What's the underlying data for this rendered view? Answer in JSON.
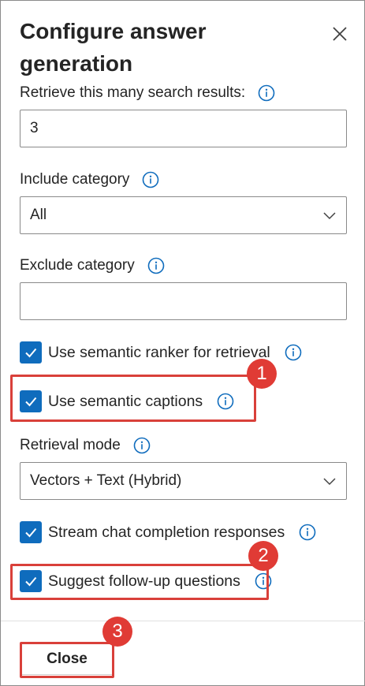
{
  "panel": {
    "title": "Configure answer generation",
    "close_icon": "close-icon"
  },
  "retrieve_count": {
    "label": "Retrieve this many search results:",
    "value": "3"
  },
  "include_category": {
    "label": "Include category",
    "selected": "All"
  },
  "exclude_category": {
    "label": "Exclude category",
    "value": ""
  },
  "semantic_ranker": {
    "label": "Use semantic ranker for retrieval",
    "checked": true
  },
  "semantic_captions": {
    "label": "Use semantic captions",
    "checked": true
  },
  "retrieval_mode": {
    "label": "Retrieval mode",
    "selected": "Vectors + Text (Hybrid)"
  },
  "stream_responses": {
    "label": "Stream chat completion responses",
    "checked": true
  },
  "followup_questions": {
    "label": "Suggest follow-up questions",
    "checked": true
  },
  "footer": {
    "close_label": "Close"
  },
  "callouts": [
    "1",
    "2",
    "3"
  ],
  "colors": {
    "accent": "#0f6cbd",
    "highlight": "#d9403a",
    "badge": "#e03b35"
  }
}
